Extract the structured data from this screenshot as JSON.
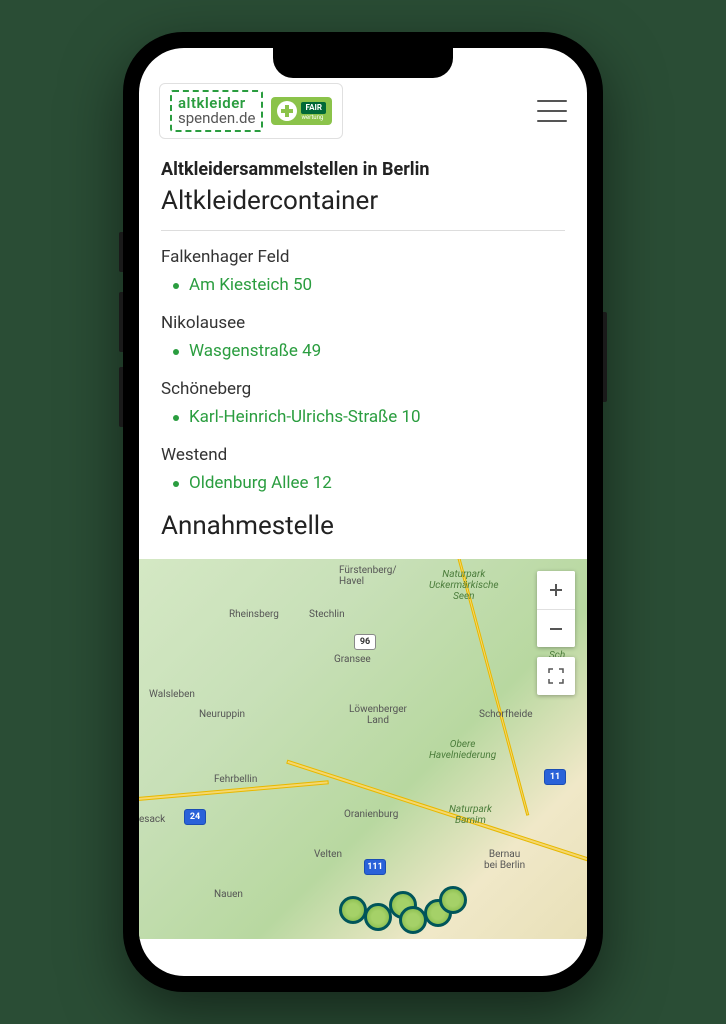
{
  "logo": {
    "line1": "altkleider",
    "line2": "spenden.de",
    "badge_main": "FAIR",
    "badge_sub": "wertung"
  },
  "title": "Altkleidersammelstellen in Berlin",
  "section1_heading": "Altkleidercontainer",
  "section2_heading": "Annahmestelle",
  "districts": [
    {
      "name": "Falkenhager Feld",
      "addresses": [
        "Am Kiesteich 50"
      ]
    },
    {
      "name": "Nikolausee",
      "addresses": [
        "Wasgenstraße 49"
      ]
    },
    {
      "name": "Schöneberg",
      "addresses": [
        "Karl-Heinrich-Ulrichs-Straße 10"
      ]
    },
    {
      "name": "Westend",
      "addresses": [
        "Oldenburg Allee 12"
      ]
    }
  ],
  "map": {
    "labels": {
      "furstenberg": "Fürstenberg/\nHavel",
      "uckermark": "Naturpark\nUckermärkische\nSeen",
      "rheinsberg": "Rheinsberg",
      "stechlin": "Stechlin",
      "gransee": "Gransee",
      "walsleben": "Walsleben",
      "neuruppin": "Neuruppin",
      "lowenberg": "Löwenberger\nLand",
      "schorfheide": "Schorfheide",
      "obere": "Obere\nHavelniederung",
      "fehrbellin": "Fehrbellin",
      "oranienburg": "Oranienburg",
      "barnim": "Naturpark\nBarnim",
      "velten": "Velten",
      "bernau": "Bernau\nbei Berlin",
      "nauen": "Nauen",
      "biosphere": "Bios\nSch",
      "sack": "esack"
    },
    "hwy": {
      "a24": "24",
      "a96": "96",
      "a111": "111",
      "a11": "11"
    }
  }
}
